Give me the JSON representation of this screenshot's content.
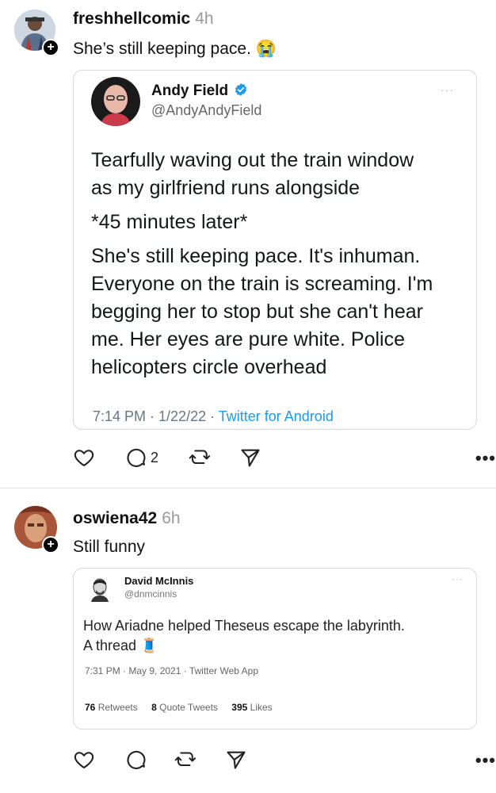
{
  "posts": [
    {
      "username": "freshhellcomic",
      "time": "4h",
      "caption": "She’s still keeping pace.",
      "caption_emoji": "😭",
      "quote": {
        "name": "Andy Field",
        "handle": "@AndyAndyField",
        "verified": true,
        "body_lines": [
          "Tearfully waving out the train window",
          "as my girlfriend runs alongside",
          "*45 minutes later*",
          "She's still keeping pace. It's inhuman.",
          "Everyone on the train is screaming. I'm",
          "begging her to stop but she can't hear",
          "me. Her eyes are pure white. Police",
          "helicopters circle overhead"
        ],
        "date": "7:14 PM · 1/22/22 · ",
        "source": "Twitter for Android"
      },
      "actions": {
        "reply_count": "2"
      }
    },
    {
      "username": "oswiena42",
      "time": "6h",
      "caption": "Still funny",
      "quote": {
        "name": "David McInnis",
        "handle": "@dnmcinnis",
        "body_line1": "How Ariadne helped Theseus escape the labyrinth.",
        "body_line2": "A thread",
        "thread_emoji": "🧵",
        "date": "7:31 PM · May 9, 2021 · Twitter Web App",
        "stats": {
          "retweets_count": "76",
          "retweets_label": "Retweets",
          "quotes_count": "8",
          "quotes_label": "Quote Tweets",
          "likes_count": "395",
          "likes_label": "Likes"
        }
      }
    }
  ],
  "ui": {
    "follow_symbol": "+",
    "overflow_symbol": "•••",
    "card_more_symbol": "···",
    "colors": {
      "verified": "#1d9bf0",
      "link": "#1d9bf0"
    },
    "icons": [
      "heart-icon",
      "comment-icon",
      "repost-icon",
      "share-icon",
      "verified-badge-icon"
    ]
  }
}
